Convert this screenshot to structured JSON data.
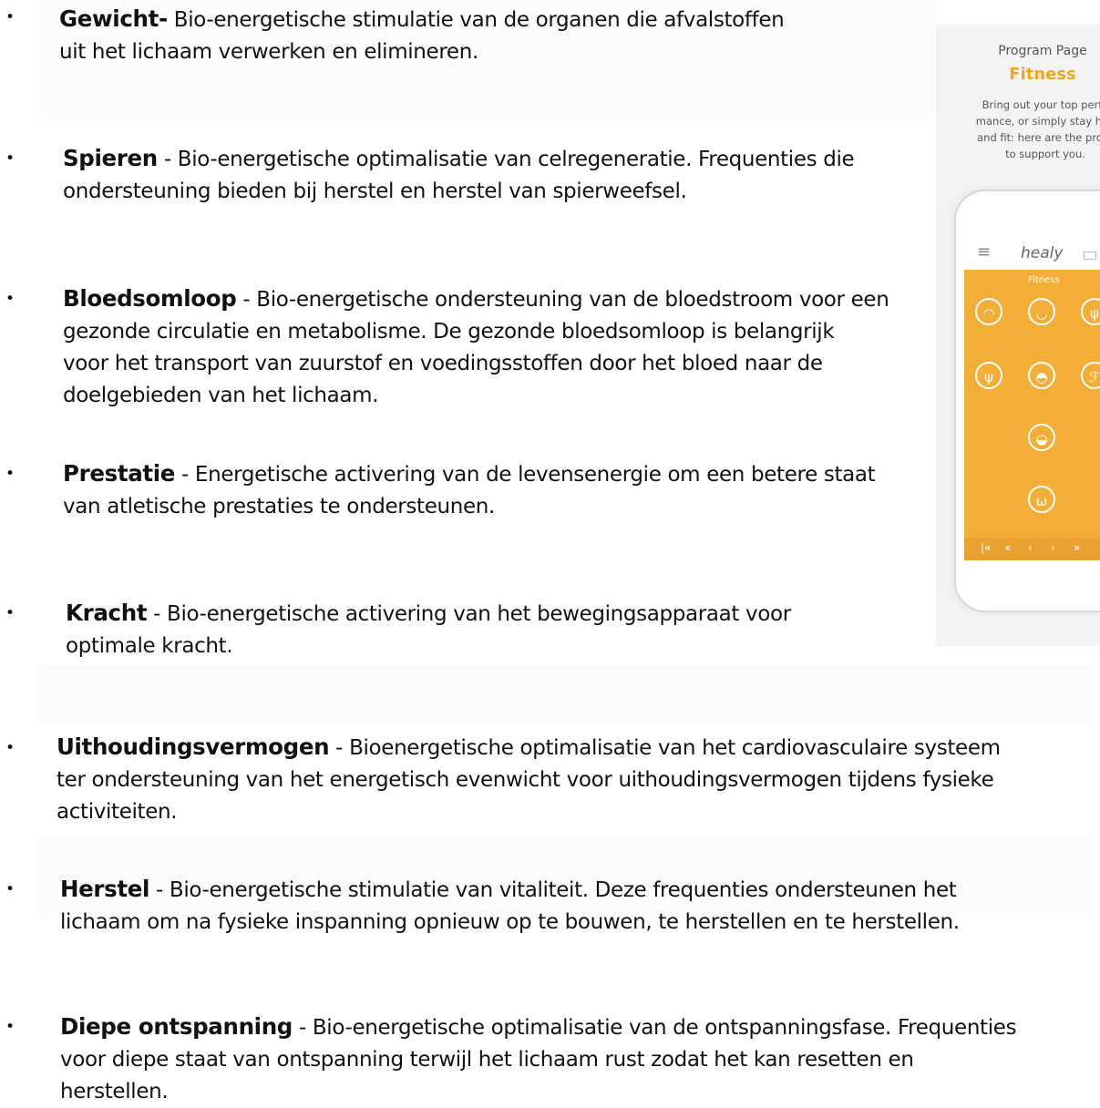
{
  "bullet": "•",
  "items": [
    {
      "term": "Gewicht-",
      "text": " Bio-energetische stimulatie van de organen die afvalstoffen",
      "text2": "uit het lichaam verwerken en elimineren."
    },
    {
      "term": "Spieren",
      "text": " - Bio-energetische optimalisatie van celregeneratie. Frequenties die",
      "text2": "ondersteuning bieden bij herstel en herstel van spierweefsel."
    },
    {
      "term": "Bloedsomloop",
      "text": " - Bio-energetische ondersteuning van de bloedstroom voor een",
      "text2": "gezonde circulatie en metabolisme. De gezonde bloedsomloop is belangrijk",
      "text3": "voor het transport van zuurstof en voedingsstoffen door het bloed naar de",
      "text4": "doelgebieden van het lichaam."
    },
    {
      "term": "Prestatie",
      "text": " - Energetische activering van de levensenergie om een betere staat",
      "text2": "van atletische prestaties te ondersteunen."
    },
    {
      "term": "Kracht",
      "text": " - Bio-energetische activering van het bewegingsapparaat voor",
      "text2": "optimale kracht."
    },
    {
      "term": "Uithoudingsvermogen",
      "text": " - Bioenergetische optimalisatie van het cardiovasculaire systeem",
      "text2": "ter ondersteuning van het energetisch evenwicht voor uithoudingsvermogen tijdens fysieke",
      "text3": "activiteiten."
    },
    {
      "term": "Herstel",
      "text": " - Bio-energetische stimulatie van vitaliteit. Deze frequenties ondersteunen het",
      "text2": "lichaam om na fysieke inspanning opnieuw op te bouwen, te herstellen en te herstellen."
    },
    {
      "term": "Diepe ontspanning",
      "text": " - Bio-energetische optimalisatie van de ontspanningsfase. Frequenties",
      "text2": "voor diepe staat van ontspanning terwijl het lichaam rust zodat het kan resetten en",
      "text3": "herstellen."
    }
  ],
  "program_card": {
    "subtitle": "Program Page",
    "title": "Fitness",
    "desc1": "Bring out your top perfo",
    "desc2": "mance, or simply stay hea",
    "desc3": "and fit: here are the progr",
    "desc4": "to support you.",
    "app_logo": "healy",
    "screen_label": "Fitness",
    "menu_icon": "menu-icon",
    "nav_icons": [
      "first-page-icon",
      "fast-back-icon",
      "back-icon",
      "forward-icon",
      "fast-forward-icon"
    ],
    "accent_color": "#f0a81c",
    "screen_color": "#f3ae38"
  }
}
